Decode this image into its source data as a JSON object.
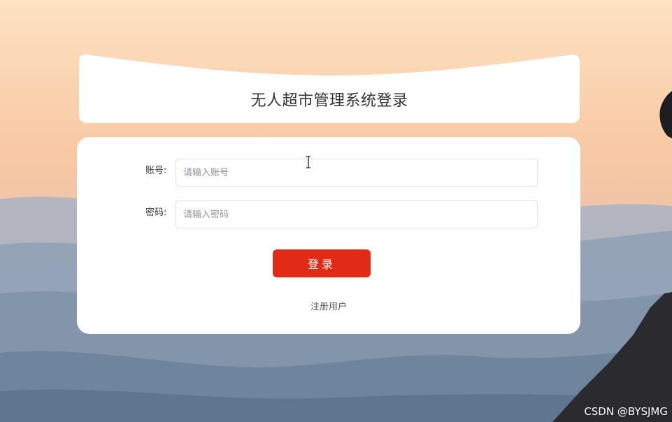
{
  "header": {
    "title": "无人超市管理系统登录"
  },
  "form": {
    "account_label": "账号:",
    "account_placeholder": "请输入账号",
    "account_value": "",
    "password_label": "密码:",
    "password_placeholder": "请输入密码",
    "password_value": "",
    "login_label": "登录",
    "register_label": "注册用户"
  },
  "watermark": "CSDN @BYSJMG",
  "colors": {
    "accent": "#e12b16",
    "card": "#ffffff"
  }
}
